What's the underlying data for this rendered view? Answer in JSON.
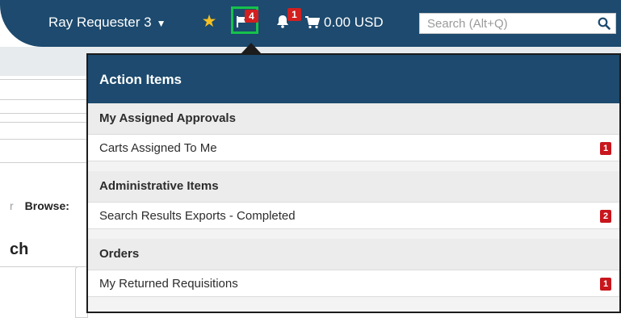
{
  "header": {
    "user_name": "Ray Requester 3",
    "action_items_count": "4",
    "notifications_count": "1",
    "cart_total": "0.00 USD",
    "search_placeholder": "Search (Alt+Q)"
  },
  "background": {
    "link_fragment": "r",
    "browse_label": "Browse:",
    "heading_fragment": "ch"
  },
  "action_items": {
    "title": "Action Items",
    "sections": [
      {
        "label": "My Assigned Approvals",
        "items": [
          {
            "label": "Carts Assigned To Me",
            "count": "1"
          }
        ]
      },
      {
        "label": "Administrative Items",
        "items": [
          {
            "label": "Search Results Exports - Completed",
            "count": "2"
          }
        ]
      },
      {
        "label": "Orders",
        "items": [
          {
            "label": "My Returned Requisitions",
            "count": "1"
          }
        ]
      }
    ]
  },
  "colors": {
    "navbar": "#1d4a6e",
    "badge": "#c8161d",
    "highlight_outline": "#16c24b",
    "star": "#f5c022"
  },
  "icons": [
    "caret-down-icon",
    "star-icon",
    "flag-icon",
    "bell-icon",
    "cart-icon",
    "search-icon"
  ]
}
